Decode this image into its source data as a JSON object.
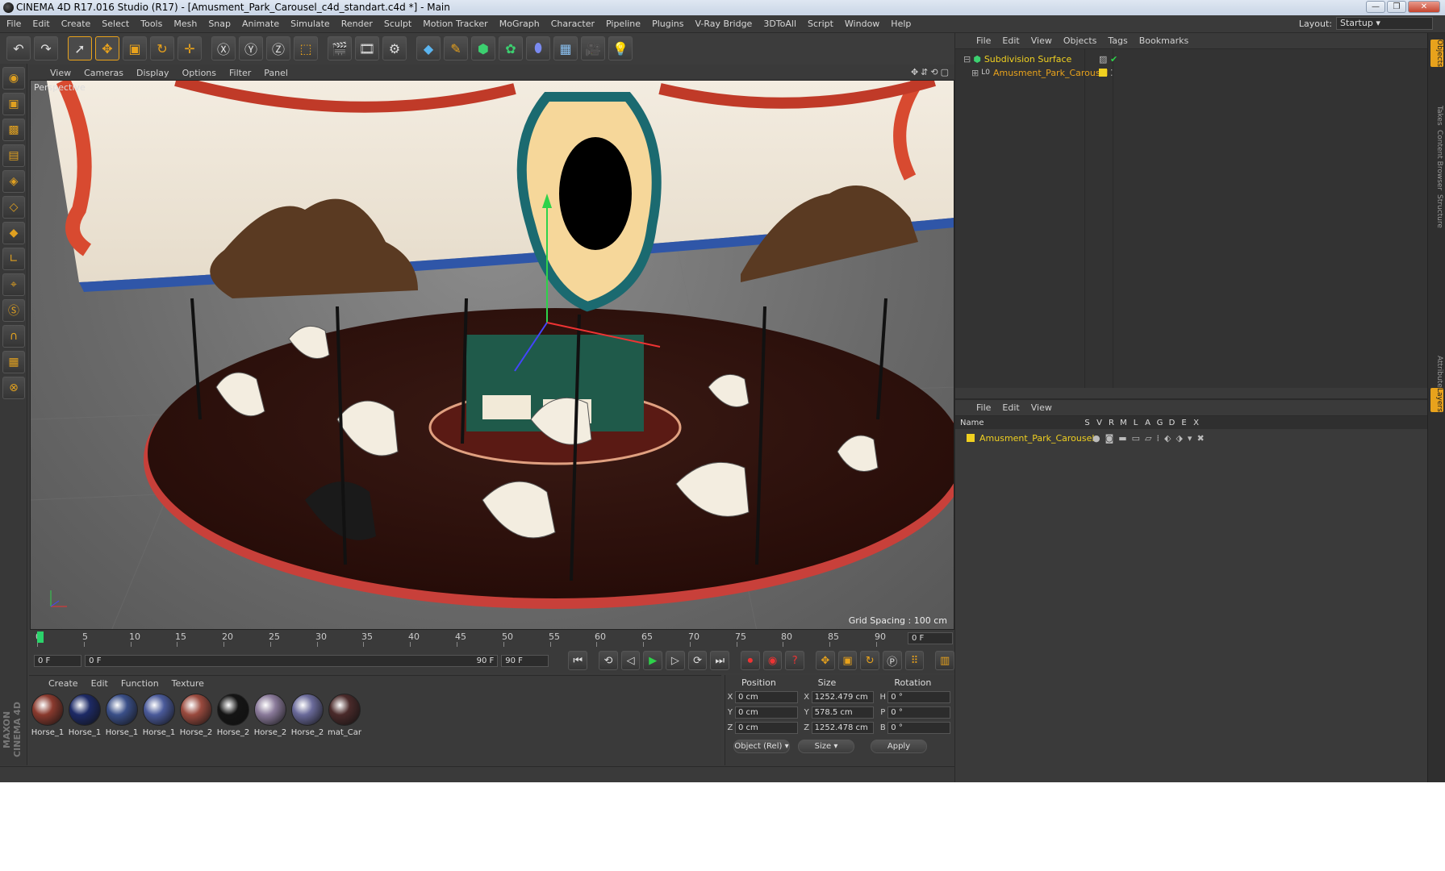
{
  "window": {
    "title": "CINEMA 4D R17.016 Studio (R17) - [Amusment_Park_Carousel_c4d_standart.c4d *] - Main",
    "controls": [
      "—",
      "❒",
      "✕"
    ]
  },
  "menubar": [
    "File",
    "Edit",
    "Create",
    "Select",
    "Tools",
    "Mesh",
    "Snap",
    "Animate",
    "Simulate",
    "Render",
    "Sculpt",
    "Motion Tracker",
    "MoGraph",
    "Character",
    "Pipeline",
    "Plugins",
    "V-Ray Bridge",
    "3DToAll",
    "Script",
    "Window",
    "Help"
  ],
  "layout": {
    "label": "Layout:",
    "value": "Startup"
  },
  "toolbar": [
    "undo-icon",
    "redo-icon",
    "select-icon",
    "move-icon",
    "scale-icon",
    "rotate-icon",
    "live-icon",
    "x-axis-icon",
    "y-axis-icon",
    "z-axis-icon",
    "coord-icon",
    "render-view-icon",
    "render-icon",
    "render-settings-icon",
    "cube-icon",
    "pen-icon",
    "subdivision-icon",
    "array-icon",
    "deformer-icon",
    "floor-icon",
    "camera-icon",
    "light-icon"
  ],
  "viewport": {
    "menu": [
      "View",
      "Cameras",
      "Display",
      "Options",
      "Filter",
      "Panel"
    ],
    "label": "Perspective",
    "grid_spacing": "Grid Spacing : 100 cm"
  },
  "timeline": {
    "ticks": [
      "0",
      "5",
      "10",
      "15",
      "20",
      "25",
      "30",
      "35",
      "40",
      "45",
      "50",
      "55",
      "60",
      "65",
      "70",
      "75",
      "80",
      "85",
      "90"
    ],
    "current": "0 F"
  },
  "transport": {
    "start": "0 F",
    "range_start": "0 F",
    "range_end": "90 F",
    "end": "90 F"
  },
  "materials": {
    "menu": [
      "Create",
      "Edit",
      "Function",
      "Texture"
    ],
    "items": [
      {
        "name": "Horse_1",
        "color": "#8a3a2e"
      },
      {
        "name": "Horse_1",
        "color": "#1d2a66"
      },
      {
        "name": "Horse_1",
        "color": "#3a4f88"
      },
      {
        "name": "Horse_1",
        "color": "#4a5a9a"
      },
      {
        "name": "Horse_2",
        "color": "#9a4a3e"
      },
      {
        "name": "Horse_2",
        "color": "#141414"
      },
      {
        "name": "Horse_2",
        "color": "#8a7a9a"
      },
      {
        "name": "Horse_2",
        "color": "#6a6a9a"
      },
      {
        "name": "mat_Car",
        "color": "#4a2a2a"
      }
    ],
    "brand": "MAXON CINEMA 4D"
  },
  "coords": {
    "headers": [
      "Position",
      "Size",
      "Rotation"
    ],
    "rows": [
      {
        "axis": "X",
        "pos": "0 cm",
        "size_axis": "X",
        "size": "1252.479 cm",
        "rot_axis": "H",
        "rot": "0 °"
      },
      {
        "axis": "Y",
        "pos": "0 cm",
        "size_axis": "Y",
        "size": "578.5 cm",
        "rot_axis": "P",
        "rot": "0 °"
      },
      {
        "axis": "Z",
        "pos": "0 cm",
        "size_axis": "Z",
        "size": "1252.478 cm",
        "rot_axis": "B",
        "rot": "0 °"
      }
    ],
    "mode": "Object (Rel)",
    "size_mode": "Size",
    "apply": "Apply"
  },
  "objects": {
    "menu": [
      "File",
      "Edit",
      "View",
      "Objects",
      "Tags",
      "Bookmarks"
    ],
    "items": [
      {
        "name": "Subdivision Surface",
        "color": "#f0d020"
      },
      {
        "name": "Amusment_Park_Carousel",
        "color": "#e8a21c"
      }
    ]
  },
  "layers": {
    "menu": [
      "File",
      "Edit",
      "View"
    ],
    "headers": [
      "Name",
      "S",
      "V",
      "R",
      "M",
      "L",
      "A",
      "G",
      "D",
      "E",
      "X"
    ],
    "items": [
      {
        "name": "Amusment_Park_Carousel",
        "color": "#f0d020"
      }
    ]
  },
  "right_tabs": [
    "Objects",
    "Takes",
    "Content Browser",
    "Structure",
    "Attributes",
    "Layers"
  ],
  "colors": {
    "accent": "#e8a21c",
    "panel": "#3a3a3a",
    "tree": "#333333",
    "highlight_text": "#f0d020"
  }
}
